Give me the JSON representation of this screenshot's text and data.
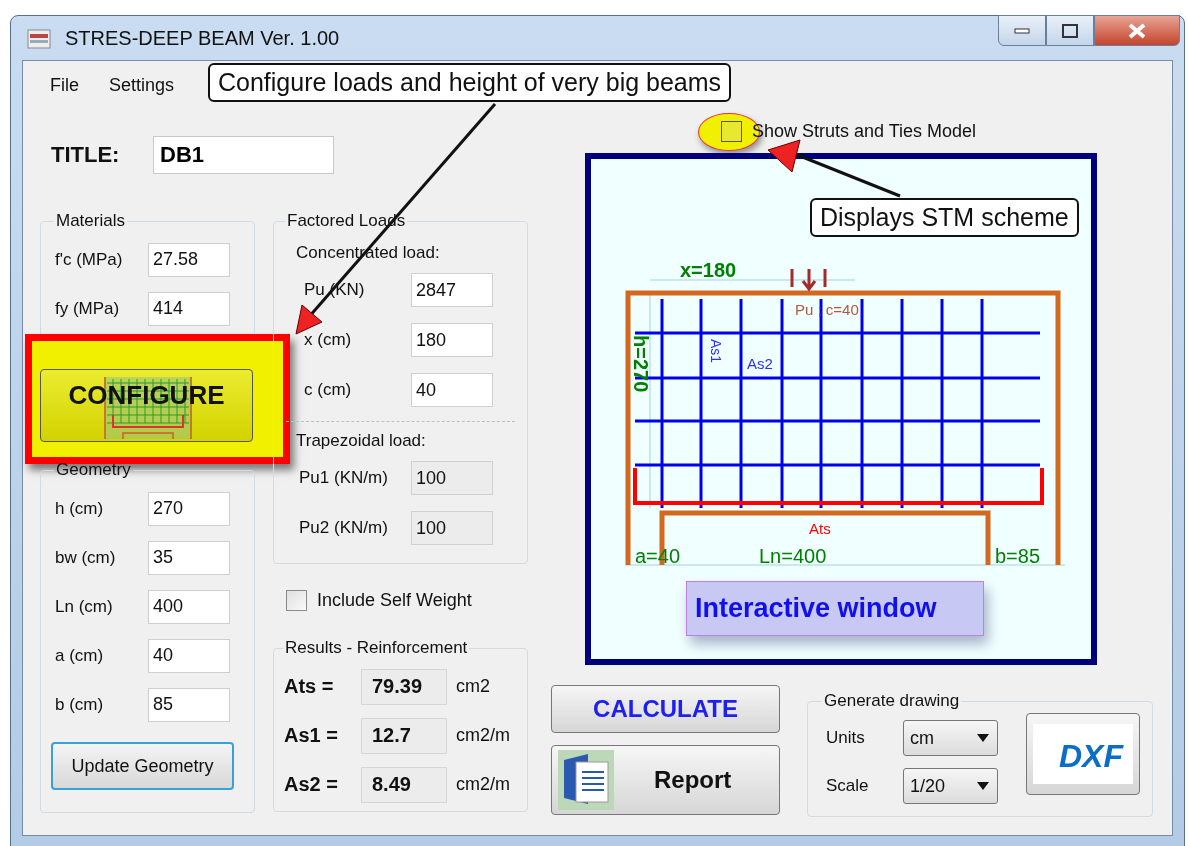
{
  "window": {
    "title": "STRES-DEEP BEAM Ver. 1.00"
  },
  "menu": [
    {
      "label": "File"
    },
    {
      "label": "Settings"
    }
  ],
  "title_field": {
    "label": "TITLE:",
    "value": "DB1"
  },
  "materials": {
    "title": "Materials",
    "fields": [
      {
        "label": "f'c (MPa)",
        "value": "27.58"
      },
      {
        "label": "fy (MPa)",
        "value": "414"
      }
    ]
  },
  "configure_button": {
    "label": "CONFIGURE",
    "highlighted": true
  },
  "geometry": {
    "title": "Geometry",
    "fields": [
      {
        "label": "h (cm)",
        "value": "270"
      },
      {
        "label": "bw (cm)",
        "value": "35"
      },
      {
        "label": "Ln (cm)",
        "value": "400"
      },
      {
        "label": "a (cm)",
        "value": "40"
      },
      {
        "label": "b (cm)",
        "value": "85"
      }
    ],
    "button": "Update Geometry"
  },
  "factored_loads": {
    "title": "Factored Loads",
    "concentrated": {
      "title": "Concentrated load:",
      "fields": [
        {
          "label": "Pu (KN)",
          "value": "2847",
          "disabled": false
        },
        {
          "label": "x (cm)",
          "value": "180",
          "disabled": false
        },
        {
          "label": "c (cm)",
          "value": "40",
          "disabled": false
        }
      ]
    },
    "trapezoidal": {
      "title": "Trapezoidal load:",
      "fields": [
        {
          "label": "Pu1 (KN/m)",
          "value": "100",
          "disabled": true
        },
        {
          "label": "Pu2 (KN/m)",
          "value": "100",
          "disabled": true
        }
      ]
    }
  },
  "self_weight": {
    "label": "Include Self Weight",
    "checked": false
  },
  "results": {
    "title": "Results - Reinforcement",
    "rows": [
      {
        "label": "Ats =",
        "value": "79.39",
        "unit": "cm2"
      },
      {
        "label": "As1 =",
        "value": "12.7",
        "unit": "cm2/m"
      },
      {
        "label": "As2 =",
        "value": "8.49",
        "unit": "cm2/m"
      }
    ]
  },
  "stm_toggle": {
    "label": "Show Struts and Ties Model",
    "checked": false,
    "highlighted": true
  },
  "drawing": {
    "x_label": "x=180",
    "load_label": "Pu ; c=40",
    "h_label": "h=270",
    "as1_label": "As1",
    "as2_label": "As2",
    "ats_label": "Ats",
    "a_label": "a=40",
    "ln_label": "Ln=400",
    "b_label": "b=85",
    "overlay": "Interactive window"
  },
  "calculate_button": {
    "label": "CALCULATE"
  },
  "report_button": {
    "label": "Report"
  },
  "generate_drawing": {
    "title": "Generate drawing",
    "fields": [
      {
        "label": "Units",
        "value": "cm"
      },
      {
        "label": "Scale",
        "value": "1/20"
      }
    ],
    "dxf_button": {
      "label": "DXF"
    }
  },
  "callouts": [
    {
      "text": "Configure loads and height of very big beams"
    },
    {
      "text": "Displays STM scheme"
    }
  ]
}
